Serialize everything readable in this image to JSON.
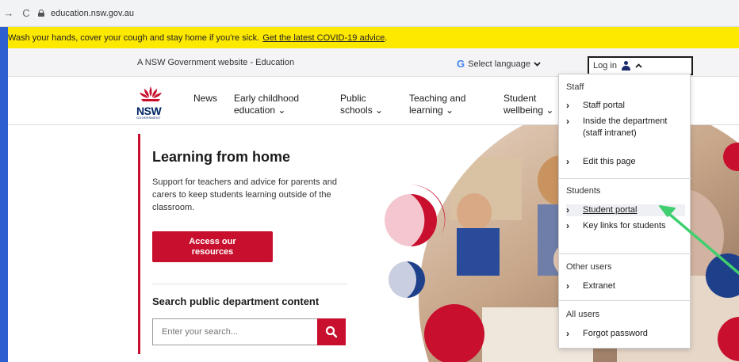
{
  "browser": {
    "back_glyph": "→",
    "reload_glyph": "C",
    "url": "education.nsw.gov.au"
  },
  "alert": {
    "text": "Wash your hands, cover your cough and stay home if you're sick.",
    "link": "Get the latest COVID-19 advice",
    "suffix": "."
  },
  "gov_bar": {
    "title": "A NSW Government website - Education",
    "language": "Select language",
    "login": "Log in"
  },
  "logo": {
    "word": "NSW",
    "sub": "GOVERNMENT"
  },
  "nav": [
    {
      "line1": "News",
      "line2": ""
    },
    {
      "line1": "Early childhood",
      "line2": "education ⌄"
    },
    {
      "line1": "Public",
      "line2": "schools ⌄"
    },
    {
      "line1": "Teaching and",
      "line2": "learning ⌄"
    },
    {
      "line1": "Student",
      "line2": "wellbeing ⌄"
    }
  ],
  "hero": {
    "title": "Learning from home",
    "text": "Support for teachers and advice for parents and carers to keep students learning outside of the classroom.",
    "button": "Access our resources",
    "search_title": "Search public department content",
    "search_placeholder": "Enter your search..."
  },
  "dropdown": {
    "staff_head": "Staff",
    "staff_items": [
      "Staff portal",
      "Inside the department (staff intranet)",
      "Edit this page"
    ],
    "students_head": "Students",
    "students_items": [
      "Student portal",
      "Key links for students"
    ],
    "other_head": "Other users",
    "other_items": [
      "Extranet"
    ],
    "all_head": "All users",
    "all_items": [
      "Forgot password"
    ]
  },
  "colors": {
    "brand_red": "#c8102e",
    "brand_navy": "#002664",
    "alert_yellow": "#fde800",
    "annotation_green": "#3fcf6f"
  }
}
